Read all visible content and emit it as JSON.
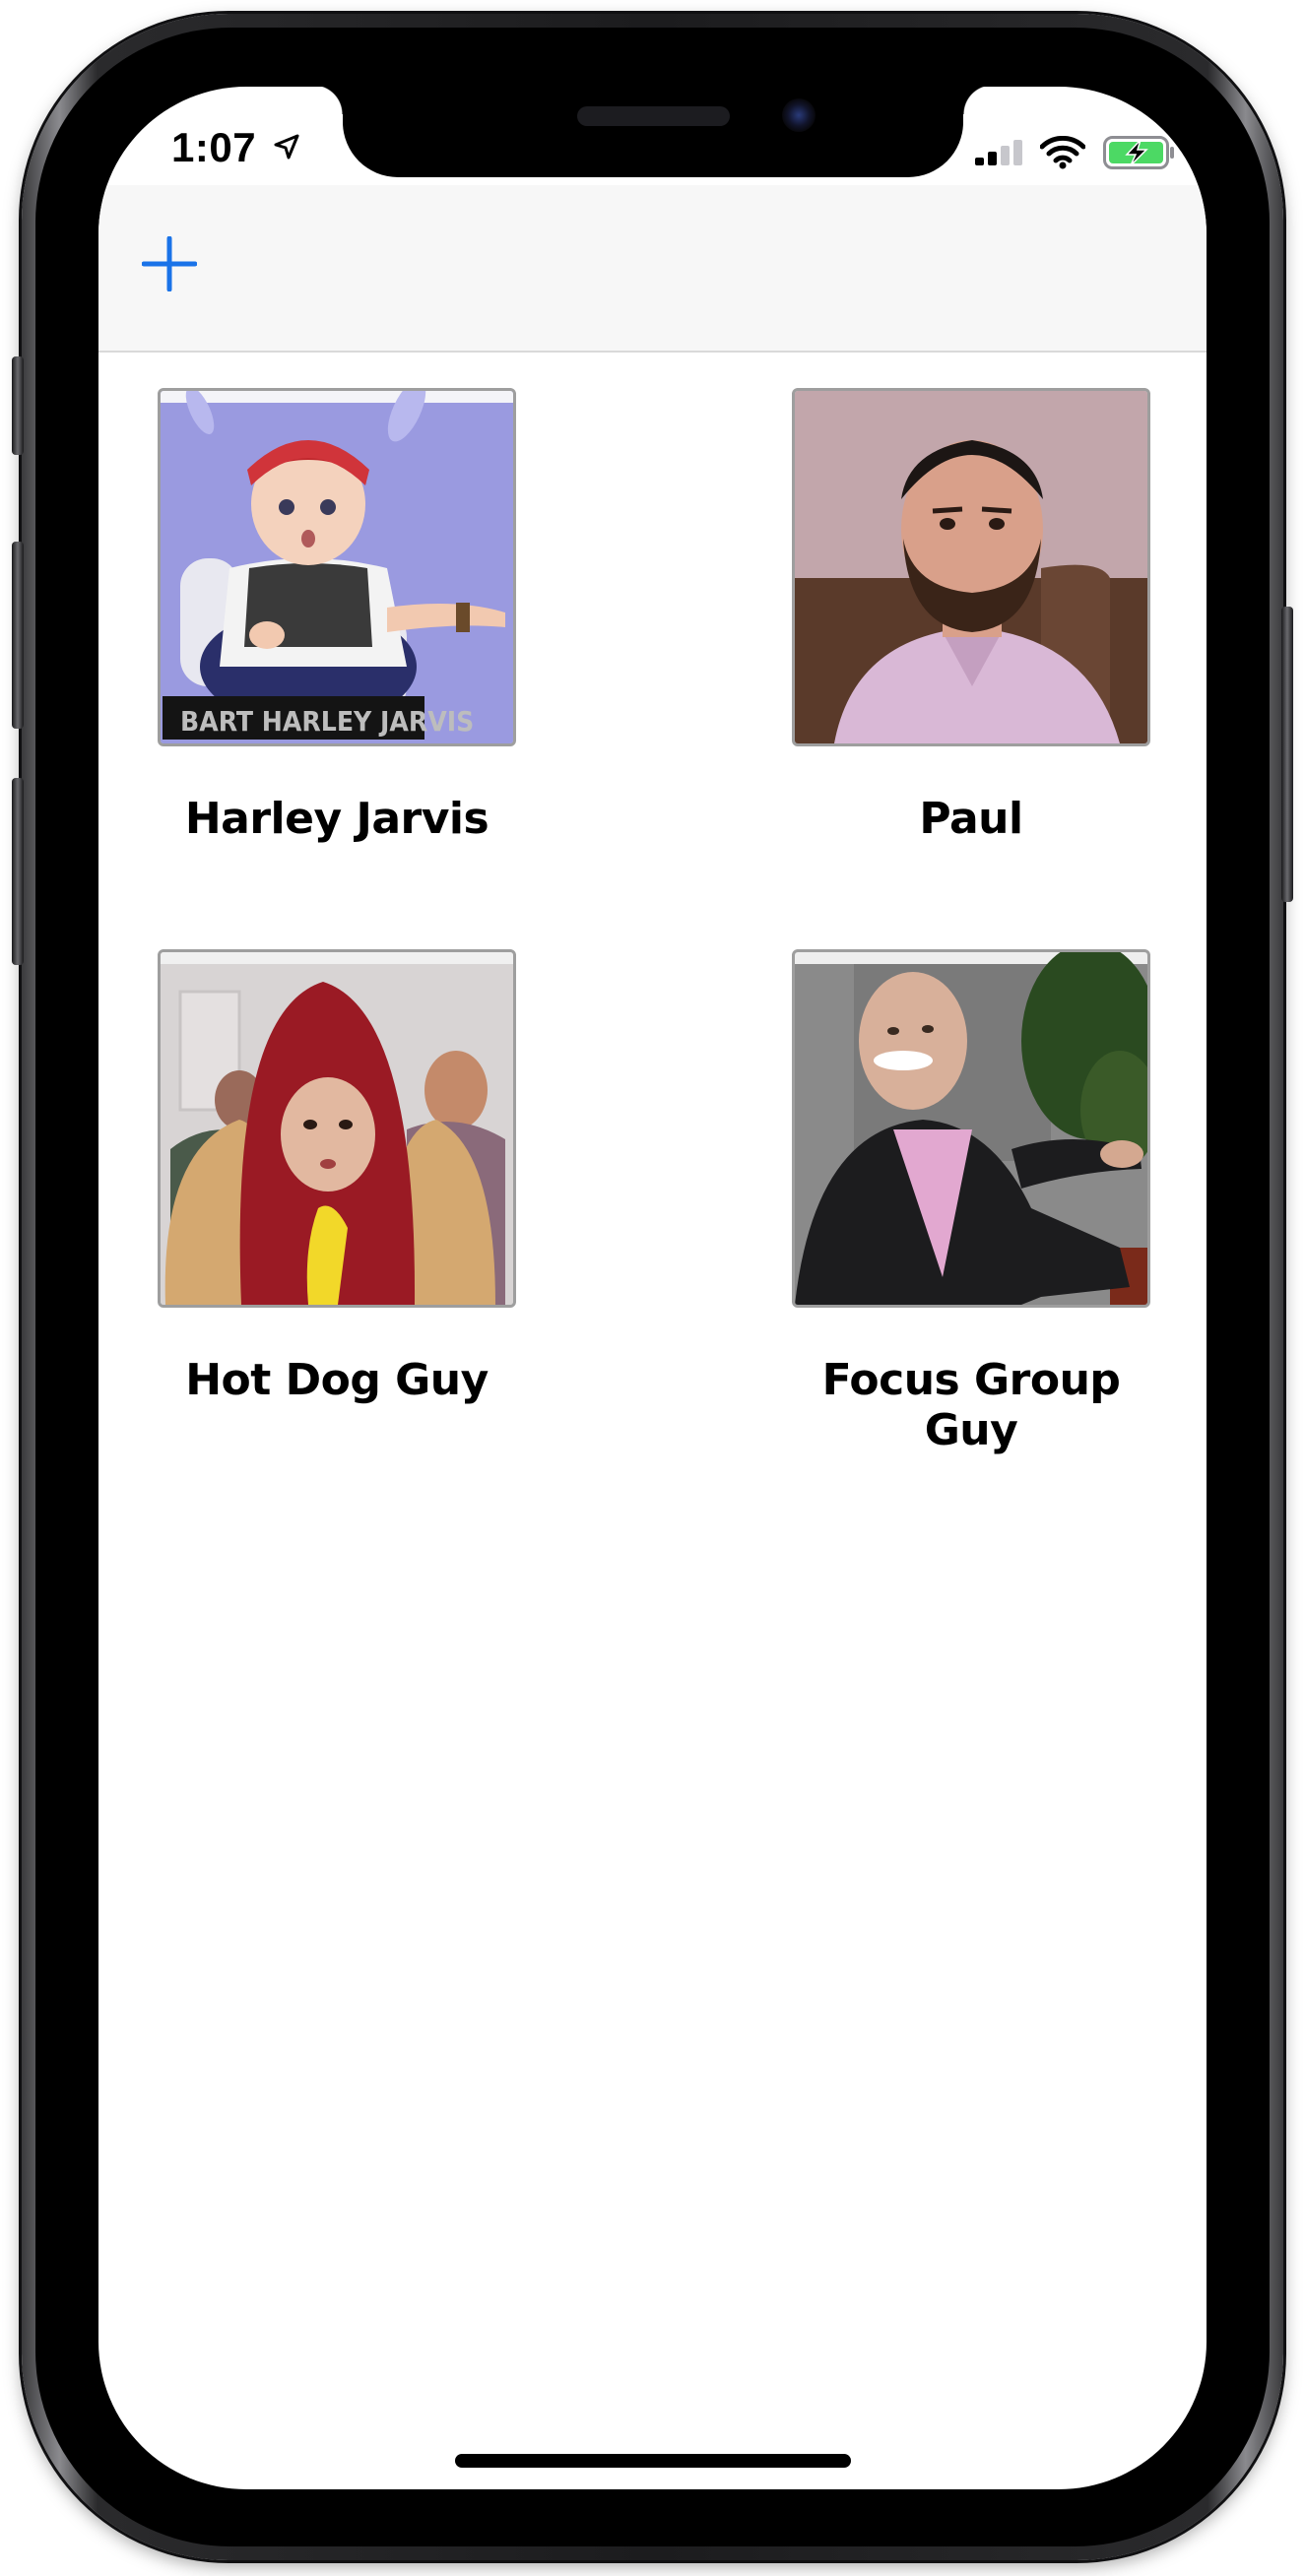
{
  "status_bar": {
    "time": "1:07",
    "location_icon": "location-arrow-icon",
    "signal_icon": "cellular-signal-icon",
    "wifi_icon": "wifi-icon",
    "battery_icon": "battery-charging-icon",
    "battery_color": "#4cd964"
  },
  "nav_bar": {
    "add_icon": "plus-icon",
    "accent_color": "#1a73e8"
  },
  "characters": [
    {
      "name": "Harley Jarvis",
      "caption_overlay": "BART HARLEY JARVIS"
    },
    {
      "name": "Paul"
    },
    {
      "name": "Hot Dog Guy"
    },
    {
      "name": "Focus Group Guy"
    }
  ]
}
